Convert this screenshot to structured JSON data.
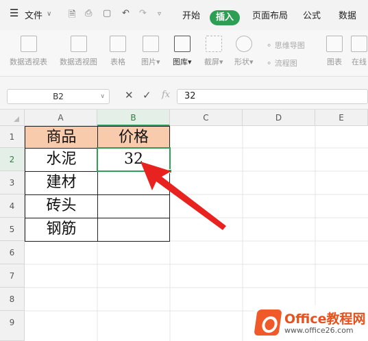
{
  "menubar": {
    "file_label": "文件",
    "tabs": [
      {
        "label": "开始"
      },
      {
        "label": "插入"
      },
      {
        "label": "页面布局"
      },
      {
        "label": "公式"
      },
      {
        "label": "数据"
      }
    ]
  },
  "ribbon": {
    "buttons": [
      {
        "label": "数据透视表"
      },
      {
        "label": "数据透视图"
      },
      {
        "label": "表格"
      },
      {
        "label": "图片"
      },
      {
        "label": "图库"
      },
      {
        "label": "截屏"
      },
      {
        "label": "形状"
      },
      {
        "label": "图表"
      },
      {
        "label": "在线"
      }
    ],
    "small_buttons": [
      {
        "label": "思维导图"
      },
      {
        "label": "流程图"
      }
    ]
  },
  "formula_bar": {
    "cell_ref": "B2",
    "fx": "fx",
    "value": "32"
  },
  "sheet": {
    "columns": [
      "A",
      "B",
      "C",
      "D",
      "E"
    ],
    "rows": [
      "1",
      "2",
      "3",
      "4",
      "5",
      "6",
      "7",
      "8",
      "9"
    ],
    "cells": {
      "A1": "商品",
      "B1": "价格",
      "A2": "水泥",
      "B2": "32",
      "A3": "建材",
      "A4": "砖头",
      "A5": "钢筋"
    },
    "header_fill": "#f8cbad",
    "selection_color": "#2e9e55"
  },
  "watermark": {
    "title": "Office教程网",
    "url": "www.office26.com"
  }
}
